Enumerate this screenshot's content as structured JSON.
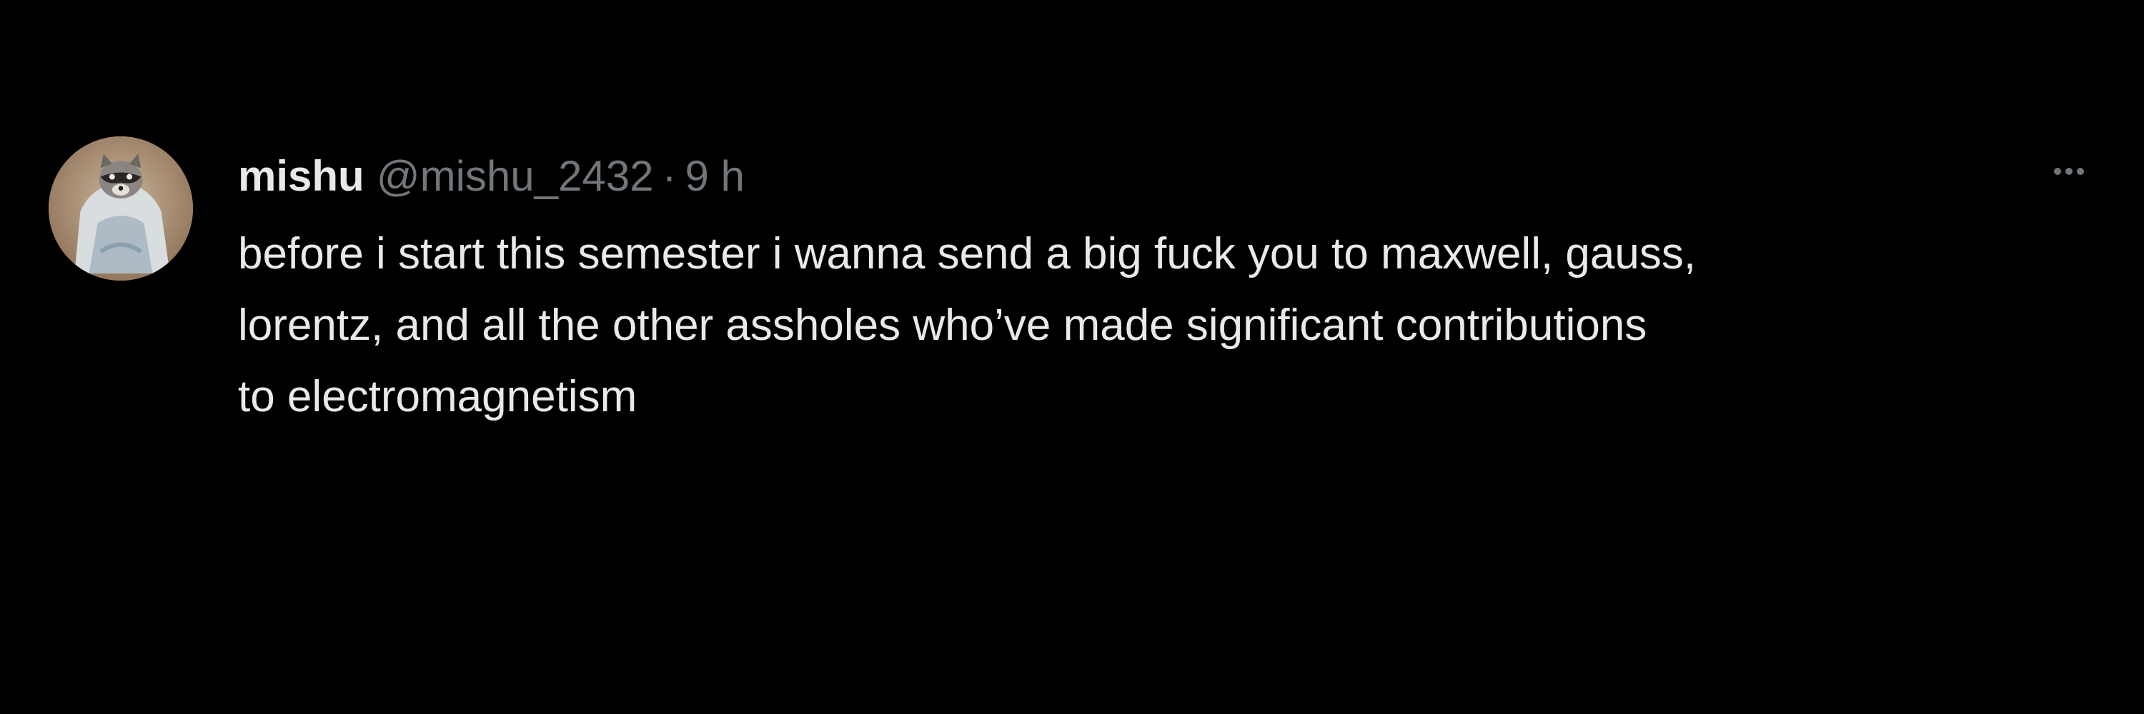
{
  "tweet": {
    "author": {
      "display_name": "mishu",
      "handle": "@mishu_2432",
      "avatar_icon": "raccoon-avatar-icon"
    },
    "separator": "·",
    "time": "9 h",
    "more_icon": "more-options-icon",
    "text_lines": [
      "before i start this semester i wanna send a big fuck you to maxwell, gauss,",
      "lorentz, and all the other assholes who’ve made significant contributions",
      "to electromagnetism"
    ]
  },
  "colors": {
    "background": "#000000",
    "primary_text": "#e7e9ea",
    "secondary_text": "#71767b"
  }
}
